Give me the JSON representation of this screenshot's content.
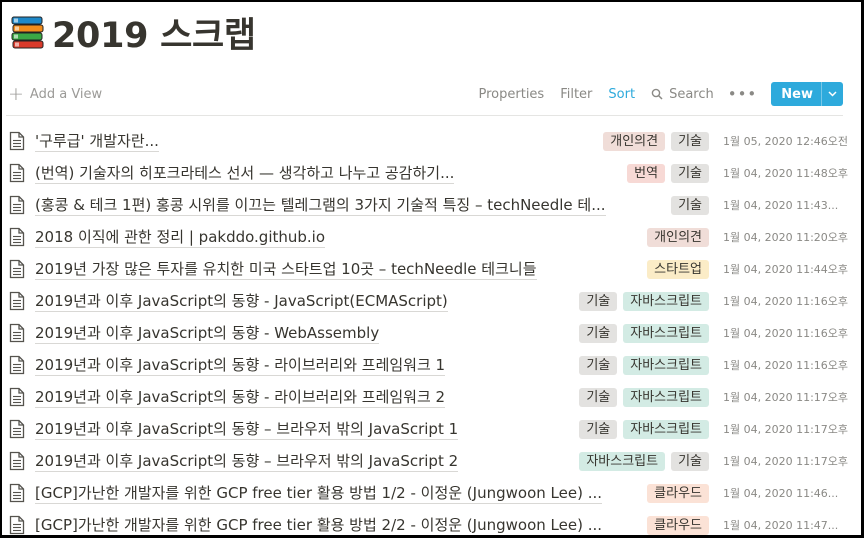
{
  "page": {
    "title": "2019 스크랩",
    "icon": "books-icon"
  },
  "toolbar": {
    "add_view": "Add a View",
    "properties": "Properties",
    "filter": "Filter",
    "sort": "Sort",
    "search": "Search",
    "more": "•••",
    "new": "New"
  },
  "colors": {
    "accent": "#2eaadc",
    "tag_opinion": "#f4dfda",
    "tag_tech": "#e3e2e0",
    "tag_translation": "#fadcd9",
    "tag_startup": "#fdecc8",
    "tag_javascript": "#d3ece6",
    "tag_cloud": "#fbe4da"
  },
  "rows": [
    {
      "title": "'구루급' 개발자란...",
      "tags": [
        {
          "text": "개인의견",
          "color": "#f0ddd8"
        },
        {
          "text": "기술",
          "color": "#e3e2e0"
        }
      ],
      "date": "1월 05, 2020 12:46오전"
    },
    {
      "title": "(번역) 기술자의 히포크라테스 선서 — 생각하고 나누고 공감하기...",
      "tags": [
        {
          "text": "번역",
          "color": "#f7d9d5"
        },
        {
          "text": "기술",
          "color": "#e3e2e0"
        }
      ],
      "date": "1월 04, 2020 11:48오후"
    },
    {
      "title": "(홍콩 & 테크 1편) 홍콩 시위를 이끄는 텔레그램의 3가지 기술적 특징 – techNeedle 테...",
      "tags": [
        {
          "text": "기술",
          "color": "#e3e2e0"
        }
      ],
      "date": "1월 04, 2020 11:43..."
    },
    {
      "title": "2018 이직에 관한 정리 | pakddo.github.io",
      "tags": [
        {
          "text": "개인의견",
          "color": "#f0ddd8"
        }
      ],
      "date": "1월 04, 2020 11:20오후"
    },
    {
      "title": "2019년 가장 많은 투자를 유치한 미국 스타트업 10곳 – techNeedle 테크니들",
      "tags": [
        {
          "text": "스타트업",
          "color": "#fbecc7"
        }
      ],
      "date": "1월 04, 2020 11:44오후"
    },
    {
      "title": "2019년과 이후 JavaScript의 동향 - JavaScript(ECMAScript)",
      "tags": [
        {
          "text": "기술",
          "color": "#e3e2e0"
        },
        {
          "text": "자바스크립트",
          "color": "#d3ebe4"
        }
      ],
      "date": "1월 04, 2020 11:16오후"
    },
    {
      "title": "2019년과 이후 JavaScript의 동향 - WebAssembly",
      "tags": [
        {
          "text": "기술",
          "color": "#e3e2e0"
        },
        {
          "text": "자바스크립트",
          "color": "#d3ebe4"
        }
      ],
      "date": "1월 04, 2020 11:16오후"
    },
    {
      "title": "2019년과 이후 JavaScript의 동향 - 라이브러리와 프레임워크 1",
      "tags": [
        {
          "text": "기술",
          "color": "#e3e2e0"
        },
        {
          "text": "자바스크립트",
          "color": "#d3ebe4"
        }
      ],
      "date": "1월 04, 2020 11:16오후"
    },
    {
      "title": "2019년과 이후 JavaScript의 동향 - 라이브러리와 프레임워크 2",
      "tags": [
        {
          "text": "기술",
          "color": "#e3e2e0"
        },
        {
          "text": "자바스크립트",
          "color": "#d3ebe4"
        }
      ],
      "date": "1월 04, 2020 11:17오후"
    },
    {
      "title": "2019년과 이후 JavaScript의 동향 – 브라우저 밖의 JavaScript 1",
      "tags": [
        {
          "text": "기술",
          "color": "#e3e2e0"
        },
        {
          "text": "자바스크립트",
          "color": "#d3ebe4"
        }
      ],
      "date": "1월 04, 2020 11:17오후"
    },
    {
      "title": "2019년과 이후 JavaScript의 동향 – 브라우저 밖의 JavaScript 2",
      "tags": [
        {
          "text": "자바스크립트",
          "color": "#d3ebe4"
        },
        {
          "text": "기술",
          "color": "#e3e2e0"
        }
      ],
      "date": "1월 04, 2020 11:17오후"
    },
    {
      "title": "[GCP]가난한 개발자를 위한 GCP free tier 활용 방법 1/2 - 이정운 (Jungwoon Lee) ...",
      "tags": [
        {
          "text": "클라우드",
          "color": "#fbe2d6"
        }
      ],
      "date": "1월 04, 2020 11:46..."
    },
    {
      "title": "[GCP]가난한 개발자를 위한 GCP free tier 활용 방법 2/2 - 이정운 (Jungwoon Lee) ...",
      "tags": [
        {
          "text": "클라우드",
          "color": "#fbe2d6"
        }
      ],
      "date": "1월 04, 2020 11:47..."
    }
  ]
}
